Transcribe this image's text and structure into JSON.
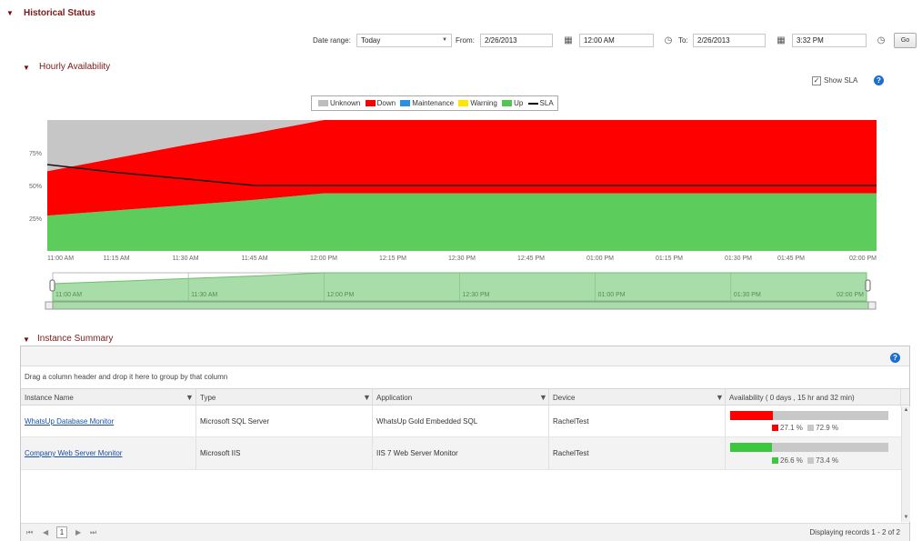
{
  "header": {
    "title": "Historical Status"
  },
  "range": {
    "date_range_label": "Date range:",
    "date_range_value": "Today",
    "from_label": "From:",
    "from_date": "2/26/2013",
    "from_time": "12:00 AM",
    "to_label": "To:",
    "to_date": "2/26/2013",
    "to_time": "3:32 PM",
    "go_label": "Go"
  },
  "hourly": {
    "title": "Hourly Availability",
    "show_sla_label": "Show SLA",
    "show_sla_checked": true
  },
  "legend": {
    "items": [
      {
        "label": "Unknown",
        "color": "#bdbdbd"
      },
      {
        "label": "Down",
        "color": "#ff0000"
      },
      {
        "label": "Maintenance",
        "color": "#2a8ee6"
      },
      {
        "label": "Warning",
        "color": "#ffe600"
      },
      {
        "label": "Up",
        "color": "#50c850"
      }
    ],
    "sla_label": "SLA"
  },
  "chart_data": {
    "type": "area",
    "x": [
      "11:00 AM",
      "11:15 AM",
      "11:30 AM",
      "11:45 AM",
      "12:00 PM",
      "12:15 PM",
      "12:30 PM",
      "12:45 PM",
      "01:00 PM",
      "01:15 PM",
      "01:30 PM",
      "01:45 PM",
      "02:00 PM"
    ],
    "series": [
      {
        "name": "Up",
        "color": "#5ccc5c",
        "values": [
          27,
          31,
          35,
          39,
          44,
          44,
          44,
          44,
          44,
          44,
          44,
          44,
          44
        ]
      },
      {
        "name": "Down",
        "color": "#ff0000",
        "values": [
          34,
          40,
          46,
          51,
          56,
          56,
          56,
          56,
          56,
          56,
          56,
          56,
          56
        ]
      },
      {
        "name": "Unknown",
        "color": "#c6c6c6",
        "values": [
          39,
          29,
          19,
          10,
          0,
          0,
          0,
          0,
          0,
          0,
          0,
          0,
          0
        ]
      }
    ],
    "sla": {
      "name": "SLA",
      "values": [
        66,
        60,
        55,
        50,
        50,
        50,
        50,
        50,
        50,
        50,
        50,
        50,
        50
      ]
    },
    "yticks": [
      "75%",
      "50%",
      "25%"
    ],
    "ytick_values": [
      75,
      50,
      25
    ],
    "ylim": [
      0,
      100
    ],
    "navigator_ticks": [
      "11:00 AM",
      "11:30 AM",
      "12:00 PM",
      "12:30 PM",
      "01:00 PM",
      "01:30 PM",
      "02:00 PM"
    ]
  },
  "summary": {
    "title": "Instance Summary",
    "group_hint": "Drag a column header and drop it here to group by that column",
    "columns": [
      "Instance Name",
      "Type",
      "Application",
      "Device",
      "Availability ( 0 days , 15 hr and 32 min)"
    ],
    "rows": [
      {
        "name": "WhatsUp Database Monitor",
        "type": "Microsoft SQL Server",
        "application": "WhatsUp Gold Embedded SQL",
        "device": "RachelTest",
        "availability_fraction": 0.271,
        "bar_color": "#ff0000",
        "pct_main": "27.1 %",
        "pct_other": "72.9 %"
      },
      {
        "name": "Company Web Server Monitor",
        "type": "Microsoft IIS",
        "application": "IIS 7 Web Server Monitor",
        "device": "RachelTest",
        "availability_fraction": 0.266,
        "bar_color": "#3cc83c",
        "pct_main": "26.6 %",
        "pct_other": "73.4 %"
      }
    ],
    "pager": {
      "page": "1",
      "status": "Displaying records 1 - 2 of 2"
    }
  }
}
